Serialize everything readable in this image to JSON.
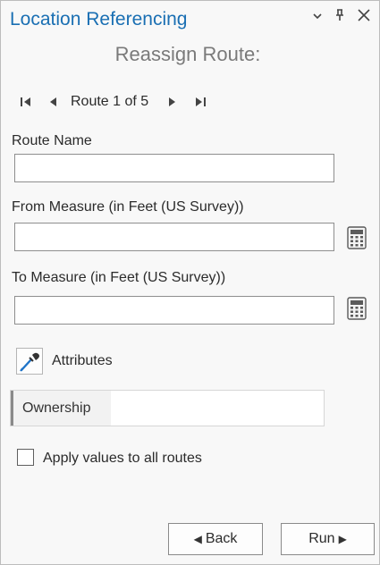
{
  "pane": {
    "title": "Location Referencing",
    "controls": {
      "options": "▾",
      "pin": "📌",
      "close": "✕"
    }
  },
  "tool": {
    "subtitle": "Reassign Route:"
  },
  "navigator": {
    "label": "Route 1 of 5",
    "first_icon": "first-page-icon",
    "prev_icon": "previous-icon",
    "next_icon": "next-icon",
    "last_icon": "last-page-icon"
  },
  "form": {
    "route_name_label": "Route Name",
    "route_name_value": "",
    "from_measure_label": "From Measure (in Feet (US Survey))",
    "from_measure_value": "",
    "to_measure_label": "To Measure (in Feet (US Survey))",
    "to_measure_value": ""
  },
  "attributes": {
    "label": "Attributes",
    "rows": [
      {
        "key": "Ownership",
        "value": ""
      }
    ]
  },
  "apply_all": {
    "label": "Apply values to all routes",
    "checked": false
  },
  "buttons": {
    "back": "Back",
    "run": "Run"
  },
  "colors": {
    "title_blue": "#1a6fb3",
    "subtitle_gray": "#7a7a7a"
  }
}
